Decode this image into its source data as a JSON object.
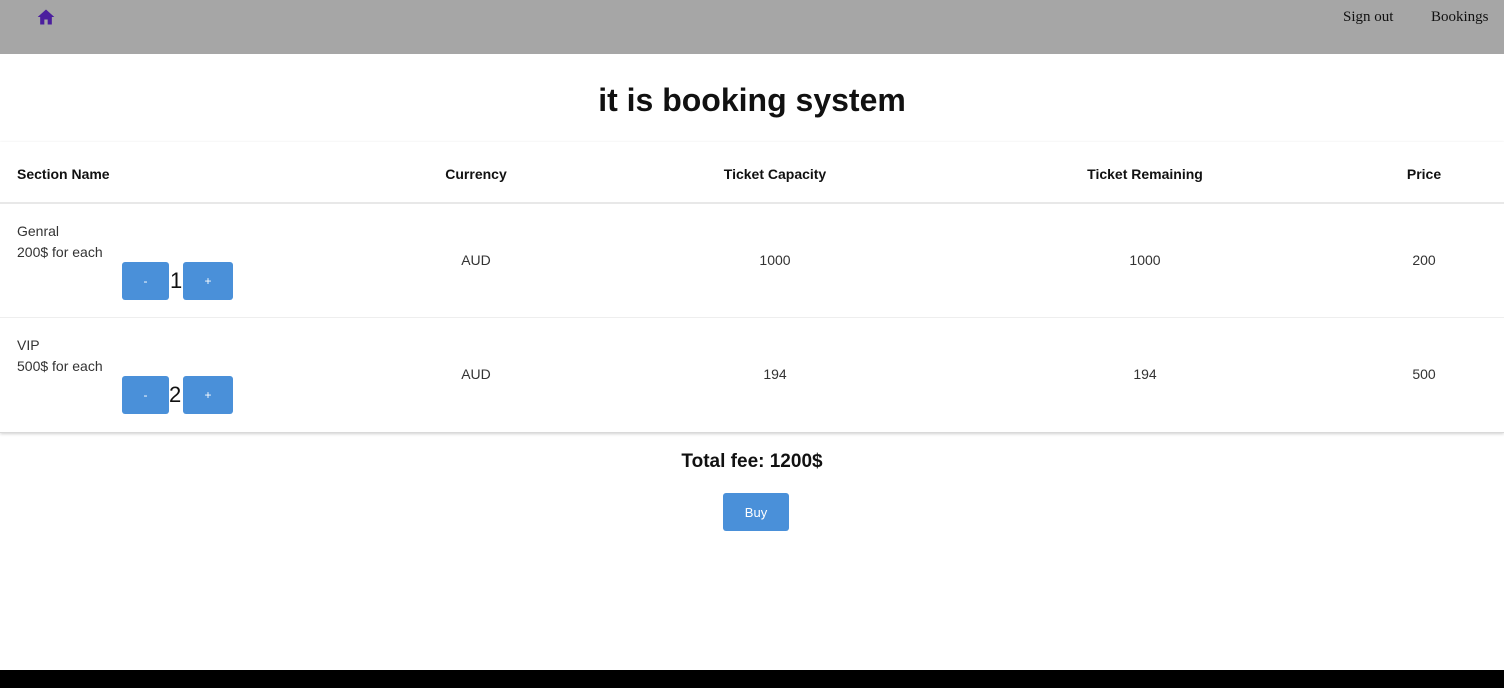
{
  "header": {
    "home_icon": "home-icon",
    "icon_color": "#4b1e9e",
    "links": {
      "sign_out": "Sign out",
      "bookings": "Bookings"
    }
  },
  "page": {
    "title": "it is booking system"
  },
  "table": {
    "columns": {
      "section_name": "Section Name",
      "currency": "Currency",
      "ticket_capacity": "Ticket Capacity",
      "ticket_remaining": "Ticket Remaining",
      "price": "Price"
    },
    "rows": [
      {
        "name": "Genral",
        "each": "200$ for each",
        "minus": "-",
        "quantity": "1",
        "plus": "+",
        "currency": "AUD",
        "capacity": "1000",
        "remaining": "1000",
        "price": "200"
      },
      {
        "name": "VIP",
        "each": "500$ for each",
        "minus": "-",
        "quantity": "2",
        "plus": "+",
        "currency": "AUD",
        "capacity": "194",
        "remaining": "194",
        "price": "500"
      }
    ]
  },
  "summary": {
    "total": "Total fee: 1200$",
    "buy_label": "Buy"
  },
  "colors": {
    "topbar": "#a6a6a6",
    "button": "#4a90d9"
  }
}
